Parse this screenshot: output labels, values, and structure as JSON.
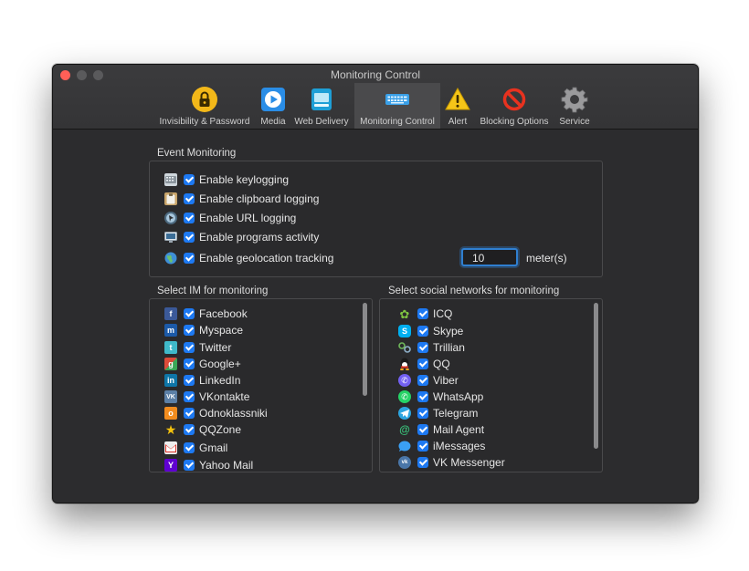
{
  "window": {
    "title": "Monitoring Control"
  },
  "toolbar": [
    {
      "label": "Invisibility & Password",
      "icon": "lock-icon"
    },
    {
      "label": "Media",
      "icon": "play-icon"
    },
    {
      "label": "Web Delivery",
      "icon": "web-delivery-icon"
    },
    {
      "label": "Monitoring Control",
      "icon": "keyboard-icon",
      "active": true
    },
    {
      "label": "Alert",
      "icon": "warning-icon"
    },
    {
      "label": "Blocking Options",
      "icon": "blocked-icon"
    },
    {
      "label": "Service",
      "icon": "gear-icon"
    }
  ],
  "event_monitoring": {
    "label": "Event Monitoring",
    "items": [
      {
        "label": "Enable keylogging",
        "icon": "keyboard-icon",
        "checked": true
      },
      {
        "label": "Enable clipboard logging",
        "icon": "clipboard-icon",
        "checked": true
      },
      {
        "label": "Enable URL logging",
        "icon": "url-icon",
        "checked": true
      },
      {
        "label": "Enable programs activity",
        "icon": "monitor-icon",
        "checked": true
      },
      {
        "label": "Enable geolocation tracking",
        "icon": "globe-icon",
        "checked": true
      }
    ],
    "geolocation_distance": "10",
    "distance_unit": "meter(s)"
  },
  "im": {
    "label": "Select IM for monitoring",
    "items": [
      {
        "label": "Facebook",
        "icon": "facebook-icon",
        "checked": true
      },
      {
        "label": "Myspace",
        "icon": "myspace-icon",
        "checked": true
      },
      {
        "label": "Twitter",
        "icon": "twitter-icon",
        "checked": true
      },
      {
        "label": "Google+",
        "icon": "google-plus-icon",
        "checked": true
      },
      {
        "label": "LinkedIn",
        "icon": "linkedin-icon",
        "checked": true
      },
      {
        "label": "VKontakte",
        "icon": "vk-icon",
        "checked": true
      },
      {
        "label": "Odnoklassniki",
        "icon": "odnoklassniki-icon",
        "checked": true
      },
      {
        "label": "QQZone",
        "icon": "star-icon",
        "checked": true
      },
      {
        "label": "Gmail",
        "icon": "gmail-icon",
        "checked": true
      },
      {
        "label": "Yahoo Mail",
        "icon": "yahoo-icon",
        "checked": true
      }
    ]
  },
  "social": {
    "label": "Select social networks for monitoring",
    "items": [
      {
        "label": "ICQ",
        "icon": "icq-icon",
        "checked": true
      },
      {
        "label": "Skype",
        "icon": "skype-icon",
        "checked": true
      },
      {
        "label": "Trillian",
        "icon": "trillian-icon",
        "checked": true
      },
      {
        "label": "QQ",
        "icon": "qq-icon",
        "checked": true
      },
      {
        "label": "Viber",
        "icon": "viber-icon",
        "checked": true
      },
      {
        "label": "WhatsApp",
        "icon": "whatsapp-icon",
        "checked": true
      },
      {
        "label": "Telegram",
        "icon": "telegram-icon",
        "checked": true
      },
      {
        "label": "Mail Agent",
        "icon": "mail-agent-icon",
        "checked": true
      },
      {
        "label": "iMessages",
        "icon": "imessages-icon",
        "checked": true
      },
      {
        "label": "VK Messenger",
        "icon": "vk-messenger-icon",
        "checked": true
      }
    ]
  },
  "colors": {
    "accent": "#1d79f2",
    "window_bg": "#2c2c2e",
    "close": "#ff5f57"
  }
}
